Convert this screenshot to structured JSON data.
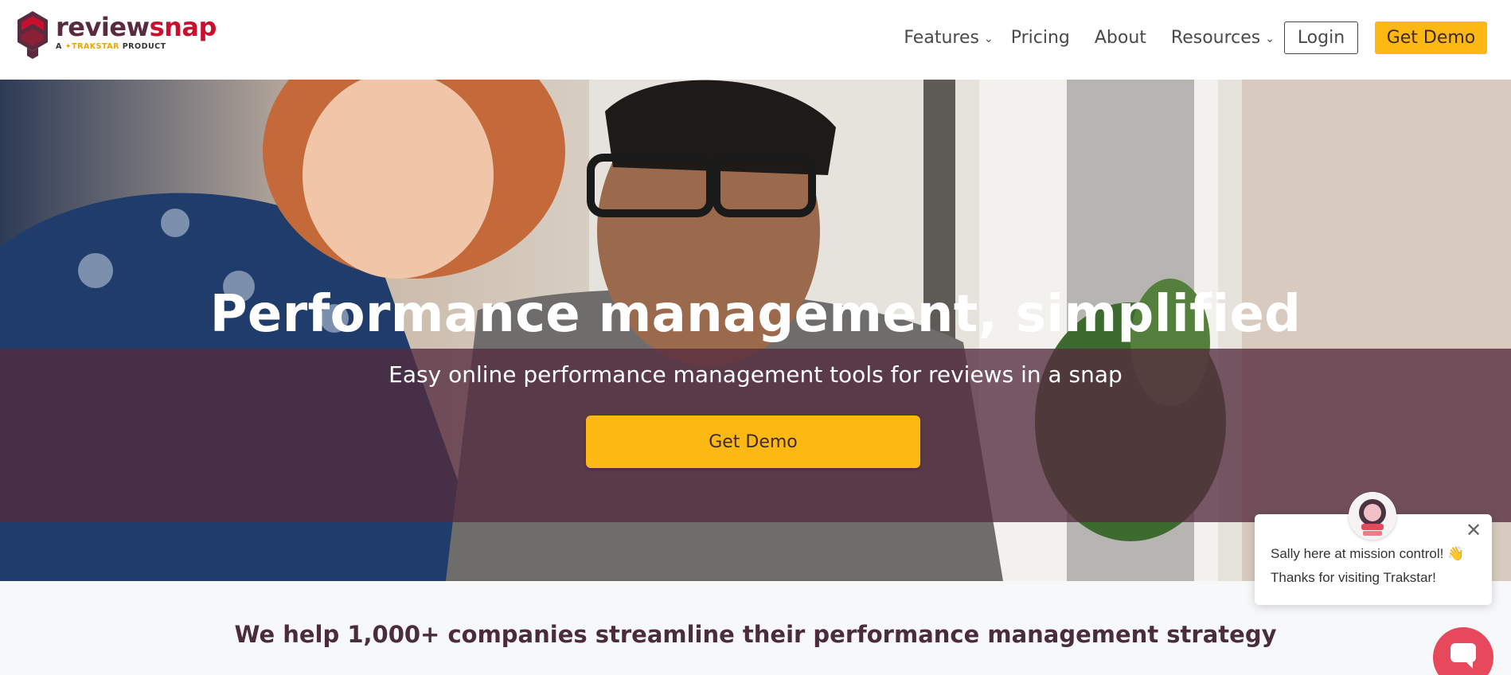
{
  "brand": {
    "name_part1": "review",
    "name_part2": "snap",
    "tagline_prefix": "A ",
    "tagline_brand": "✦TRAKSTAR",
    "tagline_suffix": " PRODUCT",
    "colors": {
      "primary": "#5a2a3e",
      "accent": "#c8102e",
      "cta": "#fdb813"
    }
  },
  "nav": {
    "items": [
      {
        "label": "Features",
        "has_dropdown": true
      },
      {
        "label": "Pricing",
        "has_dropdown": false
      },
      {
        "label": "About",
        "has_dropdown": false
      },
      {
        "label": "Resources",
        "has_dropdown": true
      }
    ],
    "login_label": "Login",
    "demo_label": "Get Demo",
    "chevron_icon": "chevron-down-icon"
  },
  "hero": {
    "title": "Performance management, simplified",
    "subtitle": "Easy online performance management tools for reviews in a snap",
    "cta_label": "Get Demo"
  },
  "section": {
    "tagline": "We help 1,000+ companies streamline their performance management strategy"
  },
  "chat": {
    "message_line1": "Sally here at mission control! 👋",
    "message_line2": "Thanks for visiting Trakstar!",
    "close_glyph": "✕",
    "avatar_icon": "astronaut-avatar-icon",
    "launcher_icon": "chat-bubble-icon"
  }
}
